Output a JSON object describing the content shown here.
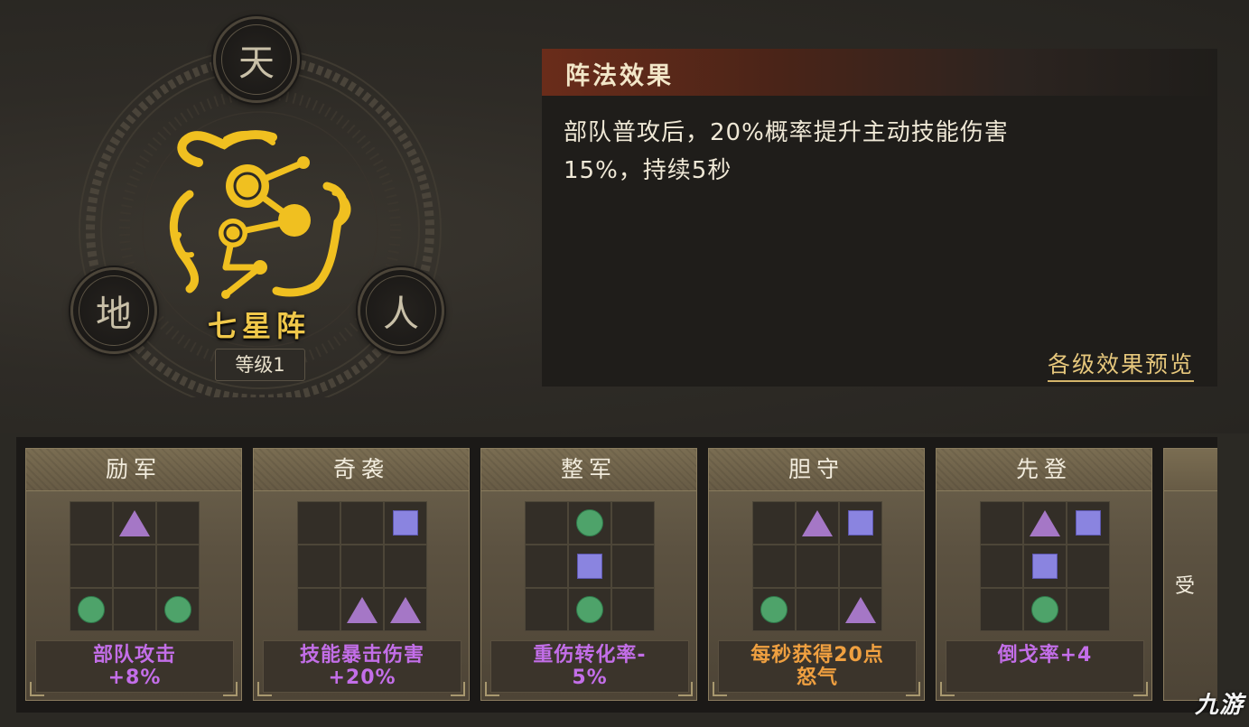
{
  "formation": {
    "seals": [
      "天",
      "地",
      "人"
    ],
    "name": "七星阵",
    "level": "等级1"
  },
  "effect_panel": {
    "title": "阵法效果",
    "description_line1": "部队普攻后，20%概率提升主动技能伤害",
    "description_line2": "15%，持续5秒",
    "preview_link": "各级效果预览"
  },
  "cards": [
    {
      "title": "励军",
      "grid": [
        "",
        "triangle",
        "",
        "",
        "",
        "",
        "circle",
        "",
        "circle"
      ],
      "effect": [
        "部队攻击",
        "+8%"
      ],
      "effect_color": "purple"
    },
    {
      "title": "奇袭",
      "grid": [
        "",
        "",
        "square",
        "",
        "",
        "",
        "",
        "triangle",
        "triangle"
      ],
      "effect": [
        "技能暴击伤害",
        "+20%"
      ],
      "effect_color": "purple"
    },
    {
      "title": "整军",
      "grid": [
        "",
        "circle",
        "",
        "",
        "square",
        "",
        "",
        "circle",
        ""
      ],
      "effect": [
        "重伤转化率-",
        "5%"
      ],
      "effect_color": "purple"
    },
    {
      "title": "胆守",
      "grid": [
        "",
        "triangle",
        "square",
        "",
        "",
        "",
        "circle",
        "",
        "triangle"
      ],
      "effect": [
        "每秒获得20点",
        "怒气"
      ],
      "effect_color": "orange"
    },
    {
      "title": "先登",
      "grid": [
        "",
        "triangle",
        "square",
        "",
        "square",
        "",
        "",
        "circle",
        ""
      ],
      "effect": [
        "倒戈率+4",
        ""
      ],
      "effect_color": "purple"
    }
  ],
  "partial_card_text": "受",
  "watermark": "九游",
  "colors": {
    "gold": "#f0c84a",
    "purple_text": "#c36ee8",
    "orange_text": "#f0a040",
    "triangle": "#a577c6",
    "square": "#8a84e0",
    "circle": "#4ea36a",
    "header_red": "#6a2c1a"
  },
  "icons": {
    "emblem": "seven-star-cloud-emblem",
    "shapes": [
      "triangle",
      "square",
      "circle"
    ]
  }
}
